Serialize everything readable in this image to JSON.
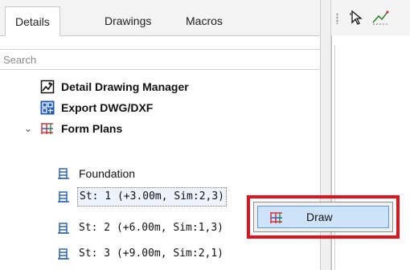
{
  "tabs": [
    {
      "label": "Details",
      "active": true
    },
    {
      "label": "Drawings",
      "active": false
    },
    {
      "label": "Macros",
      "active": false
    }
  ],
  "search": {
    "placeholder": "Search",
    "value": ""
  },
  "tree": {
    "detail_drawing_manager": {
      "label": "Detail Drawing Manager",
      "icon": "detail-drawing-manager-icon"
    },
    "export_dwg_dxf": {
      "label": "Export DWG/DXF",
      "icon": "export-dwg-icon"
    },
    "form_plans": {
      "label": "Form Plans",
      "icon": "form-plans-icon",
      "expanded": true
    },
    "children": [
      {
        "label": "Foundation",
        "icon": "form-plan-item-icon"
      },
      {
        "label": "St: 1 (+3.00m, Sim:2,3)",
        "icon": "form-plan-item-icon",
        "selected": true
      },
      {
        "label": "St: 2 (+6.00m, Sim:1,3)",
        "icon": "form-plan-item-icon"
      },
      {
        "label": "St: 3 (+9.00m, Sim:2,1)",
        "icon": "form-plan-item-icon"
      }
    ]
  },
  "toolbar_right": {
    "icons": [
      "select-pointer-icon",
      "measure-icon"
    ]
  },
  "context_menu": {
    "items": [
      {
        "label": "Draw",
        "icon": "form-plans-icon",
        "highlighted": true
      }
    ]
  },
  "colors": {
    "highlight_border": "#e0121b",
    "menu_hover": "#cfe3f8",
    "icon_blue": "#1e5ab6",
    "icon_red": "#d4262b",
    "icon_green": "#2e8b3e"
  }
}
